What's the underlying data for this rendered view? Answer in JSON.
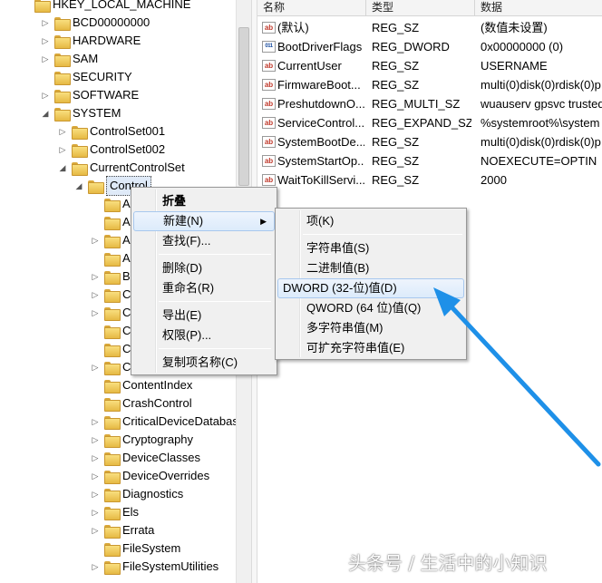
{
  "tree": {
    "root": "HKEY_LOCAL_MACHINE",
    "top_items": [
      "BCD00000000",
      "HARDWARE",
      "SAM",
      "SECURITY",
      "SOFTWARE",
      "SYSTEM"
    ],
    "system_children": [
      "ControlSet001",
      "ControlSet002",
      "CurrentControlSet"
    ],
    "selected": "Control",
    "control_children_partial": [
      "A",
      "A",
      "A",
      "A",
      "B",
      "C",
      "C",
      "C",
      "C",
      "C"
    ],
    "control_children": [
      "ContentIndex",
      "CrashControl",
      "CriticalDeviceDatabas",
      "Cryptography",
      "DeviceClasses",
      "DeviceOverrides",
      "Diagnostics",
      "Els",
      "Errata",
      "FileSystem",
      "FileSystemUtilities"
    ]
  },
  "list": {
    "headers": [
      "名称",
      "类型",
      "数据"
    ],
    "rows": [
      {
        "icon": "ab",
        "name": "(默认)",
        "type": "REG_SZ",
        "data": "(数值未设置)"
      },
      {
        "icon": "bin",
        "name": "BootDriverFlags",
        "type": "REG_DWORD",
        "data": "0x00000000 (0)"
      },
      {
        "icon": "ab",
        "name": "CurrentUser",
        "type": "REG_SZ",
        "data": "USERNAME"
      },
      {
        "icon": "ab",
        "name": "FirmwareBoot...",
        "type": "REG_SZ",
        "data": "multi(0)disk(0)rdisk(0)p"
      },
      {
        "icon": "ab",
        "name": "PreshutdownO...",
        "type": "REG_MULTI_SZ",
        "data": "wuauserv gpsvc trusted"
      },
      {
        "icon": "ab",
        "name": "ServiceControl...",
        "type": "REG_EXPAND_SZ",
        "data": "%systemroot%\\system"
      },
      {
        "icon": "ab",
        "name": "SystemBootDe...",
        "type": "REG_SZ",
        "data": "multi(0)disk(0)rdisk(0)p"
      },
      {
        "icon": "ab",
        "name": "SystemStartOp...",
        "type": "REG_SZ",
        "data": " NOEXECUTE=OPTIN"
      },
      {
        "icon": "ab",
        "name": "WaitToKillServi...",
        "type": "REG_SZ",
        "data": "2000"
      }
    ]
  },
  "context_menu": {
    "collapse": "折叠",
    "new": "新建(N)",
    "find": "查找(F)...",
    "delete": "删除(D)",
    "rename": "重命名(R)",
    "export": "导出(E)",
    "permissions": "权限(P)...",
    "copy_key_name": "复制项名称(C)"
  },
  "submenu": {
    "key": "项(K)",
    "string_value": "字符串值(S)",
    "binary_value": "二进制值(B)",
    "dword_value": "DWORD (32-位)值(D)",
    "qword_value": "QWORD (64 位)值(Q)",
    "multi_string_value": "多字符串值(M)",
    "expandable_string_value": "可扩充字符串值(E)"
  },
  "watermark": "头条号 / 生活中的小知识",
  "colors": {
    "arrow": "#1e90e8",
    "menu_highlight": "#dcebfb",
    "folder": "#f2c94c"
  }
}
